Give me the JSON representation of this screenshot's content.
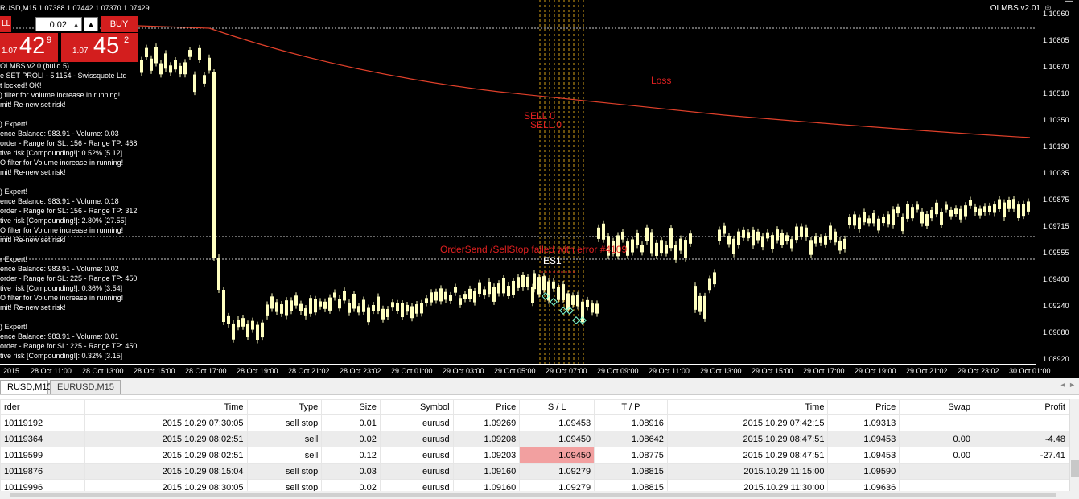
{
  "chart": {
    "title": "RUSD,M15  1.07388 1.07442 1.07370 1.07429",
    "ea_label": "OLMBS v2.01",
    "smiley": "☺",
    "close_glyph": "—",
    "lot_value": "0.02",
    "sell_tab_label": "LL",
    "buy_tab_label": "BUY",
    "sell_price": {
      "small": "1.07",
      "big": "42",
      "sup": "9"
    },
    "buy_price": {
      "small": "1.07",
      "big": "45",
      "sup": "2"
    },
    "log_lines": [
      "OLMBS v2.0 (build 5)",
      "e SET PROLI - 5 1154 - Swissquote Ltd",
      "t locked! OK!",
      ") filter for Volume increase in running!",
      "mit! Re-new set risk!",
      "",
      ") Expert!",
      "ence Balance: 983.91 - Volume: 0.03",
      "order - Range for SL: 156 - Range TP: 468",
      "tive risk [Compounding!]: 0.52% [5.12]",
      "O filter for Volume increase in running!",
      "mit! Re-new set risk!",
      "",
      ") Expert!",
      "ence Balance: 983.91 - Volume: 0.18",
      "order - Range for SL: 156 - Range TP: 312",
      "tive risk [Compounding!]: 2.80% [27.55]",
      "O filter for Volume increase in running!",
      "mit! Re-new set risk!",
      "",
      "r Expert!",
      "ence Balance: 983.91 - Volume: 0.02",
      "order - Range for SL: 225 - Range TP: 450",
      "tive risk [Compounding!]: 0.36% [3.54]",
      "O filter for Volume increase in running!",
      "mit! Re-new set risk!",
      "",
      ") Expert!",
      "ence Balance: 983.91 - Volume: 0.01",
      "order - Range for SL: 225 - Range TP: 450",
      "tive risk [Compounding!]: 0.32% [3.15]"
    ],
    "labels": {
      "loss": "Loss",
      "sell0a": "SELL 0",
      "sell0b": "SELL 0",
      "ordersend": "OrderSend /SellStop failed with error #4109",
      "es1": "ES1"
    },
    "price_ticks": [
      "1.10960",
      "1.10805",
      "1.10670",
      "1.10510",
      "1.10350",
      "1.10190",
      "1.10035",
      "1.09875",
      "1.09715",
      "1.09555",
      "1.09400",
      "1.09240",
      "1.09080",
      "1.08920"
    ],
    "time_ticks": [
      "2015",
      "28 Oct 11:00",
      "28 Oct 13:00",
      "28 Oct 15:00",
      "28 Oct 17:00",
      "28 Oct 19:00",
      "28 Oct 21:02",
      "28 Oct 23:02",
      "29 Oct 01:00",
      "29 Oct 03:00",
      "29 Oct 05:00",
      "29 Oct 07:00",
      "29 Oct 09:00",
      "29 Oct 11:00",
      "29 Oct 13:00",
      "29 Oct 15:00",
      "29 Oct 17:00",
      "29 Oct 19:00",
      "29 Oct 21:02",
      "29 Oct 23:02",
      "30 Oct 01:00"
    ],
    "colors": {
      "bg": "#000000",
      "candle": "#ffffc0",
      "ma": "#e0402a",
      "label_red": "#e02020",
      "grid_dash": "#ffffff",
      "vline": "#d4a017"
    }
  },
  "tabs": [
    {
      "label": "RUSD,M15",
      "active": true
    },
    {
      "label": "EURUSD,M15",
      "active": false
    }
  ],
  "tab_arrows": "◄ ►",
  "table": {
    "headers": [
      "rder",
      "Time",
      "Type",
      "Size",
      "Symbol",
      "Price",
      "S / L",
      "T / P",
      "Time",
      "Price",
      "Swap",
      "Profit"
    ],
    "rows": [
      {
        "order": "10119192",
        "time": "2015.10.29 07:30:05",
        "type": "sell stop",
        "size": "0.01",
        "symbol": "eurusd",
        "price": "1.09269",
        "sl": "1.09453",
        "tp": "1.08916",
        "time2": "2015.10.29 07:42:15",
        "price2": "1.09313",
        "swap": "",
        "profit": "",
        "sl_hit": false
      },
      {
        "order": "10119364",
        "time": "2015.10.29 08:02:51",
        "type": "sell",
        "size": "0.02",
        "symbol": "eurusd",
        "price": "1.09208",
        "sl": "1.09450",
        "tp": "1.08642",
        "time2": "2015.10.29 08:47:51",
        "price2": "1.09453",
        "swap": "0.00",
        "profit": "-4.48",
        "sl_hit": true
      },
      {
        "order": "10119599",
        "time": "2015.10.29 08:02:51",
        "type": "sell",
        "size": "0.12",
        "symbol": "eurusd",
        "price": "1.09203",
        "sl": "1.09450",
        "tp": "1.08775",
        "time2": "2015.10.29 08:47:51",
        "price2": "1.09453",
        "swap": "0.00",
        "profit": "-27.41",
        "sl_hit": true
      },
      {
        "order": "10119876",
        "time": "2015.10.29 08:15:04",
        "type": "sell stop",
        "size": "0.03",
        "symbol": "eurusd",
        "price": "1.09160",
        "sl": "1.09279",
        "tp": "1.08815",
        "time2": "2015.10.29 11:15:00",
        "price2": "1.09590",
        "swap": "",
        "profit": "",
        "sl_hit": false
      },
      {
        "order": "10119996",
        "time": "2015.10.29 08:30:05",
        "type": "sell stop",
        "size": "0.02",
        "symbol": "eurusd",
        "price": "1.09160",
        "sl": "1.09279",
        "tp": "1.08815",
        "time2": "2015.10.29 11:30:00",
        "price2": "1.09636",
        "swap": "",
        "profit": "",
        "sl_hit": false
      }
    ]
  }
}
